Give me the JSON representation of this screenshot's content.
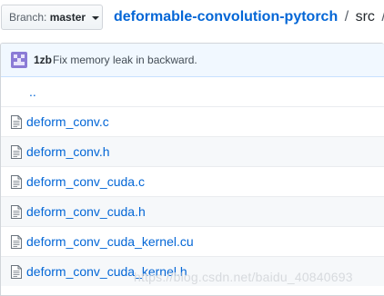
{
  "branch": {
    "label": "Branch:",
    "value": "master"
  },
  "breadcrumb": {
    "repo": "deformable-convolution-pytorch",
    "separator": "/",
    "dir": "src",
    "trailing": "/"
  },
  "commit": {
    "author": "1zb",
    "message": "Fix memory leak in backward."
  },
  "parent": {
    "label": ".."
  },
  "files": [
    {
      "name": "deform_conv.c",
      "icon": "file-icon"
    },
    {
      "name": "deform_conv.h",
      "icon": "file-icon"
    },
    {
      "name": "deform_conv_cuda.c",
      "icon": "file-icon"
    },
    {
      "name": "deform_conv_cuda.h",
      "icon": "file-icon"
    },
    {
      "name": "deform_conv_cuda_kernel.cu",
      "icon": "file-icon"
    },
    {
      "name": "deform_conv_cuda_kernel.h",
      "icon": "file-icon"
    }
  ],
  "watermark": "https://blog.csdn.net/baidu_40840693",
  "colors": {
    "link": "#0366d6",
    "commit_bg": "#f1f8ff",
    "commit_border": "#c8e1ff",
    "row_alt": "#f6f8fa"
  }
}
